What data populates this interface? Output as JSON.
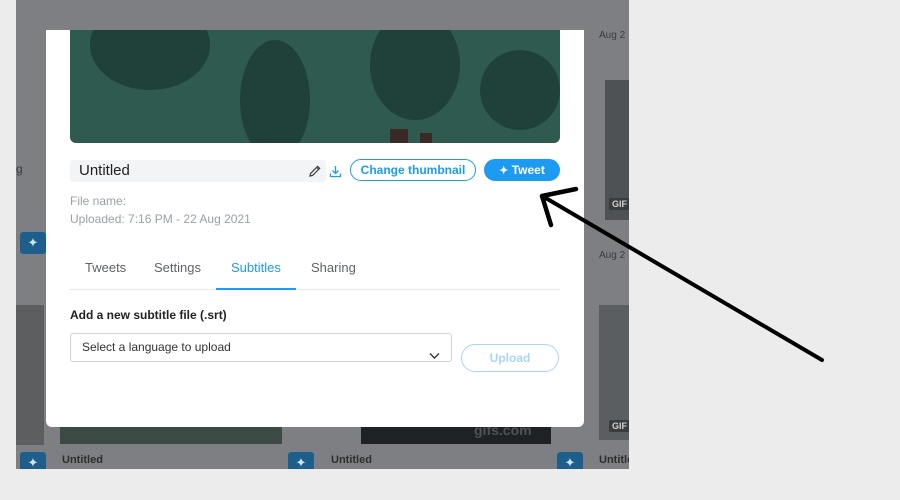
{
  "background": {
    "cards": [
      {
        "title": "Untitled"
      },
      {
        "title": "Untitled"
      },
      {
        "title": "Untitled"
      }
    ],
    "date_partial_1": "Aug 2",
    "date_partial_2": "Aug 2",
    "side_text": "g",
    "gif_badge": "GIF",
    "watermark": "gifs.com"
  },
  "modal": {
    "title_value": "Untitled",
    "change_thumbnail_label": "Change thumbnail",
    "tweet_label": "Tweet",
    "file_name_label": "File name:",
    "uploaded_label": "Uploaded: 7:16 PM - 22 Aug 2021",
    "tabs": [
      {
        "label": "Tweets",
        "active": false
      },
      {
        "label": "Settings",
        "active": false
      },
      {
        "label": "Subtitles",
        "active": true
      },
      {
        "label": "Sharing",
        "active": false
      }
    ],
    "subtitles": {
      "section_label": "Add a new subtitle file (.srt)",
      "language_placeholder": "Select a language to upload",
      "upload_label": "Upload"
    }
  },
  "icons": {
    "edit": "pencil-icon",
    "download": "download-icon",
    "tweet": "feather-icon",
    "dropdown": "chevron-down-icon"
  },
  "colors": {
    "accent": "#1d9bf0",
    "disabled_accent": "#a8d6f7",
    "overlay": "#7d7f82"
  }
}
